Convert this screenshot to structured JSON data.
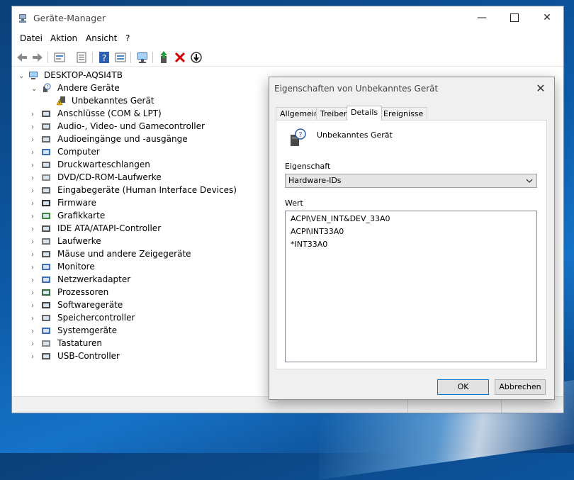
{
  "window": {
    "title": "Geräte-Manager"
  },
  "menu": [
    "Datei",
    "Aktion",
    "Ansicht",
    "?"
  ],
  "toolbar": {
    "icons": [
      "back-arrow-icon",
      "forward-arrow-icon",
      "properties-icon",
      "show-hidden-icon",
      "help-icon",
      "details-view-icon",
      "scan-hardware-icon",
      "update-driver-icon",
      "uninstall-icon",
      "disable-device-icon"
    ]
  },
  "tree": {
    "root": "DESKTOP-AQSI4TB",
    "expanded_category": "Andere Geräte",
    "expanded_child": "Unbekanntes Gerät",
    "categories": [
      "Anschlüsse (COM & LPT)",
      "Audio-, Video- und Gamecontroller",
      "Audioeingänge und -ausgänge",
      "Computer",
      "Druckwarteschlangen",
      "DVD/CD-ROM-Laufwerke",
      "Eingabegeräte (Human Interface Devices)",
      "Firmware",
      "Grafikkarte",
      "IDE ATA/ATAPI-Controller",
      "Laufwerke",
      "Mäuse und andere Zeigegeräte",
      "Monitore",
      "Netzwerkadapter",
      "Prozessoren",
      "Softwaregeräte",
      "Speichercontroller",
      "Systemgeräte",
      "Tastaturen",
      "USB-Controller"
    ]
  },
  "dialog": {
    "title": "Eigenschaften von Unbekanntes Gerät",
    "tabs": [
      "Allgemein",
      "Treiber",
      "Details",
      "Ereignisse"
    ],
    "active_tab": "Details",
    "device_name": "Unbekanntes Gerät",
    "property_label": "Eigenschaft",
    "property_value": "Hardware-IDs",
    "value_label": "Wert",
    "values": [
      "ACPI\\VEN_INT&DEV_33A0",
      "ACPI\\INT33A0",
      "*INT33A0"
    ],
    "ok_label": "OK",
    "cancel_label": "Abbrechen"
  }
}
